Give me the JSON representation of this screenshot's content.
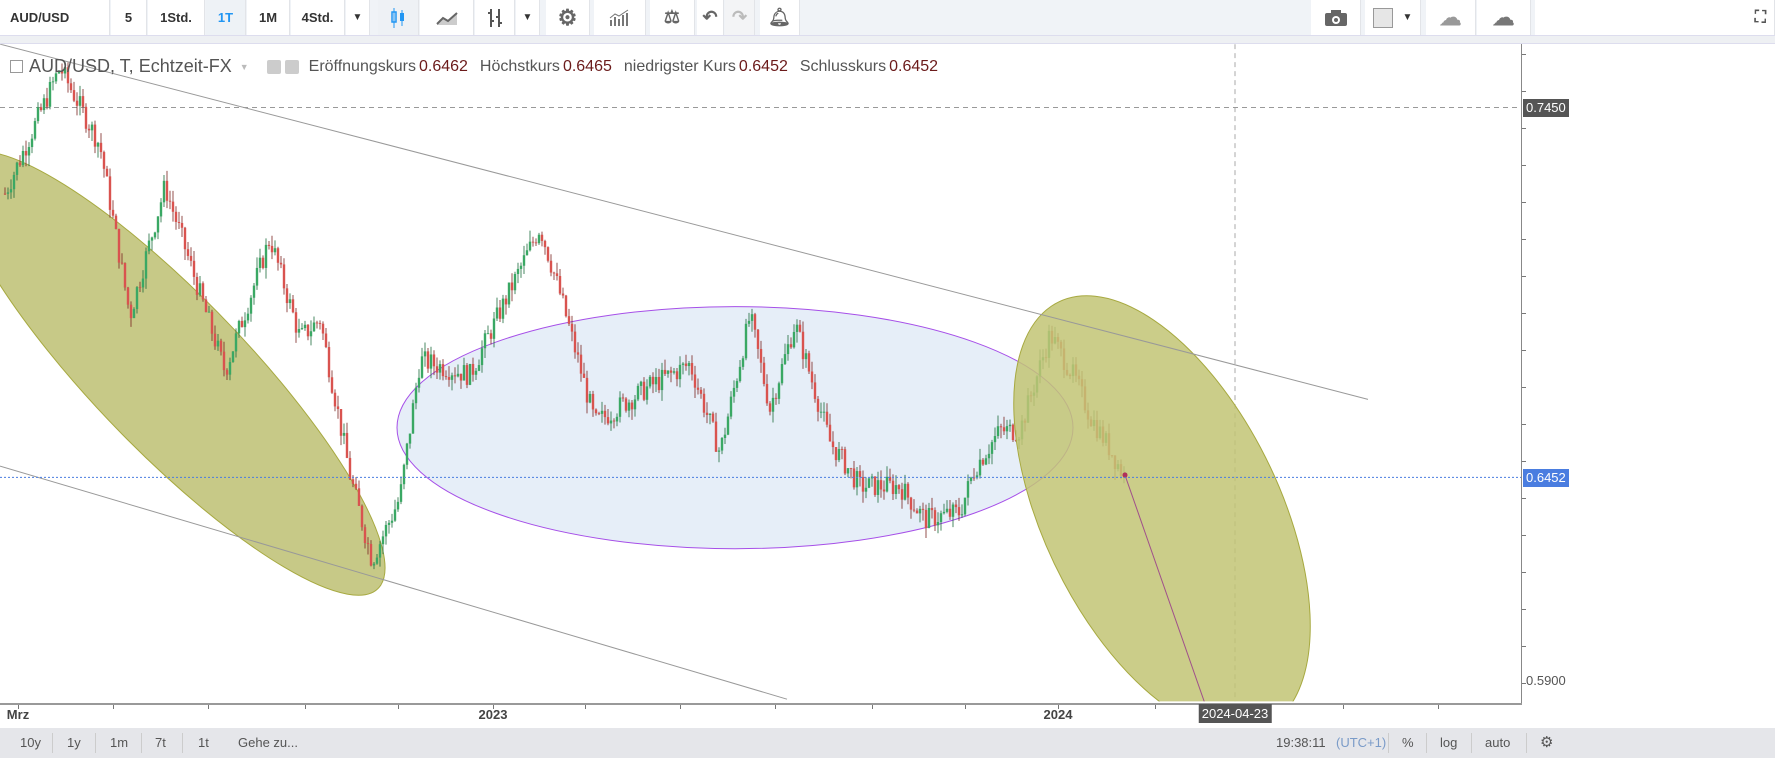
{
  "toolbar": {
    "symbol": "AUD/USD",
    "intervals": [
      "5",
      "1Std.",
      "1T",
      "1M",
      "4Std."
    ],
    "active_interval": "1T"
  },
  "legend": {
    "title": "AUD/USD, T, Echtzeit-FX",
    "open_label": "Eröffnungskurs",
    "open": "0.6462",
    "high_label": "Höchstkurs",
    "high": "0.6465",
    "low_label": "niedrigster Kurs",
    "low": "0.6452",
    "close_label": "Schlusskurs",
    "close": "0.6452"
  },
  "price_axis": {
    "labels": [
      "0.7450",
      "0.6452",
      "0.5900"
    ],
    "crosshair_price": "0.7450",
    "last_price": "0.6452"
  },
  "time_axis": {
    "labels": [
      "Mrz",
      "2023",
      "2024"
    ],
    "crosshair_date": "2024-04-23"
  },
  "bottom_bar": {
    "ranges": [
      "10y",
      "1y",
      "1m",
      "7t",
      "1t"
    ],
    "goto": "Gehe zu...",
    "clock": "19:38:11",
    "timezone": "(UTC+1)",
    "percent": "%",
    "log": "log",
    "auto": "auto"
  },
  "colors": {
    "up": "#3aa864",
    "down": "#d9534f",
    "olive": "#c5c77f",
    "ellipse_fill": "#e6eef8",
    "ellipse_stroke": "#a64fe8",
    "last_price": "#4a7de0"
  },
  "chart_data": {
    "type": "candlestick",
    "title": "AUD/USD, T, Echtzeit-FX",
    "ylim": [
      0.585,
      0.765
    ],
    "approx_close_path": [
      {
        "t": "2022-03",
        "close": 0.722
      },
      {
        "t": "2022-04",
        "close": 0.756
      },
      {
        "t": "2022-05",
        "close": 0.735
      },
      {
        "t": "2022-06",
        "close": 0.689
      },
      {
        "t": "2022-07",
        "close": 0.724
      },
      {
        "t": "2022-08",
        "close": 0.674
      },
      {
        "t": "2022-08b",
        "close": 0.71
      },
      {
        "t": "2022-09",
        "close": 0.683
      },
      {
        "t": "2022-09b",
        "close": 0.688
      },
      {
        "t": "2022-10",
        "close": 0.646
      },
      {
        "t": "2022-10b",
        "close": 0.623
      },
      {
        "t": "2022-11",
        "close": 0.64
      },
      {
        "t": "2022-11b",
        "close": 0.677
      },
      {
        "t": "2022-12",
        "close": 0.673
      },
      {
        "t": "2023-02",
        "close": 0.713
      },
      {
        "t": "2023-02b",
        "close": 0.695
      },
      {
        "t": "2023-03",
        "close": 0.66
      },
      {
        "t": "2023-04",
        "close": 0.67
      },
      {
        "t": "2023-05",
        "close": 0.676
      },
      {
        "t": "2023-05b",
        "close": 0.652
      },
      {
        "t": "2023-06",
        "close": 0.689
      },
      {
        "t": "2023-06b",
        "close": 0.664
      },
      {
        "t": "2023-07",
        "close": 0.687
      },
      {
        "t": "2023-08",
        "close": 0.655
      },
      {
        "t": "2023-09",
        "close": 0.643
      },
      {
        "t": "2023-09b",
        "close": 0.643
      },
      {
        "t": "2023-10",
        "close": 0.634
      },
      {
        "t": "2023-10b",
        "close": 0.636
      },
      {
        "t": "2023-11",
        "close": 0.648
      },
      {
        "t": "2023-11b",
        "close": 0.658
      },
      {
        "t": "2023-12",
        "close": 0.658
      },
      {
        "t": "2023-12b",
        "close": 0.684
      },
      {
        "t": "2024-01",
        "close": 0.672
      },
      {
        "t": "2024-01b",
        "close": 0.662
      },
      {
        "t": "2024-02",
        "close": 0.653
      },
      {
        "t": "2024-02b",
        "close": 0.6452
      }
    ]
  }
}
